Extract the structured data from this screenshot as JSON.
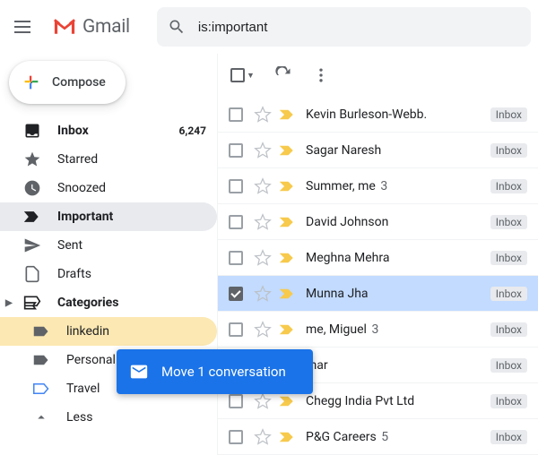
{
  "header": {
    "app_name": "Gmail",
    "search_value": "is:important"
  },
  "compose_label": "Compose",
  "sidebar": {
    "items": [
      {
        "label": "Inbox",
        "count": "6,247"
      },
      {
        "label": "Starred"
      },
      {
        "label": "Snoozed"
      },
      {
        "label": "Important"
      },
      {
        "label": "Sent"
      },
      {
        "label": "Drafts"
      }
    ],
    "categories_label": "Categories",
    "labels": [
      {
        "label": "linkedin"
      },
      {
        "label": "Personal"
      },
      {
        "label": "Travel"
      }
    ],
    "less_label": "Less"
  },
  "toolbar": {},
  "rows": [
    {
      "sender": "Kevin Burleson-Webb.",
      "tag": "Inbox"
    },
    {
      "sender": "Sagar Naresh",
      "tag": "Inbox"
    },
    {
      "sender": "Summer, me",
      "count": "3",
      "tag": "Inbox"
    },
    {
      "sender": "David Johnson",
      "tag": "Inbox"
    },
    {
      "sender": "Meghna Mehra",
      "tag": "Inbox"
    },
    {
      "sender": "Munna Jha",
      "tag": "Inbox"
    },
    {
      "sender": "me, Miguel",
      "count": "3",
      "tag": "Inbox"
    },
    {
      "sender": "mar",
      "tag": "Inbox"
    },
    {
      "sender": "Chegg India Pvt Ltd",
      "tag": "Inbox"
    },
    {
      "sender": "P&G Careers",
      "count": "5",
      "tag": "Inbox"
    }
  ],
  "toast": {
    "message": "Move 1 conversation"
  }
}
